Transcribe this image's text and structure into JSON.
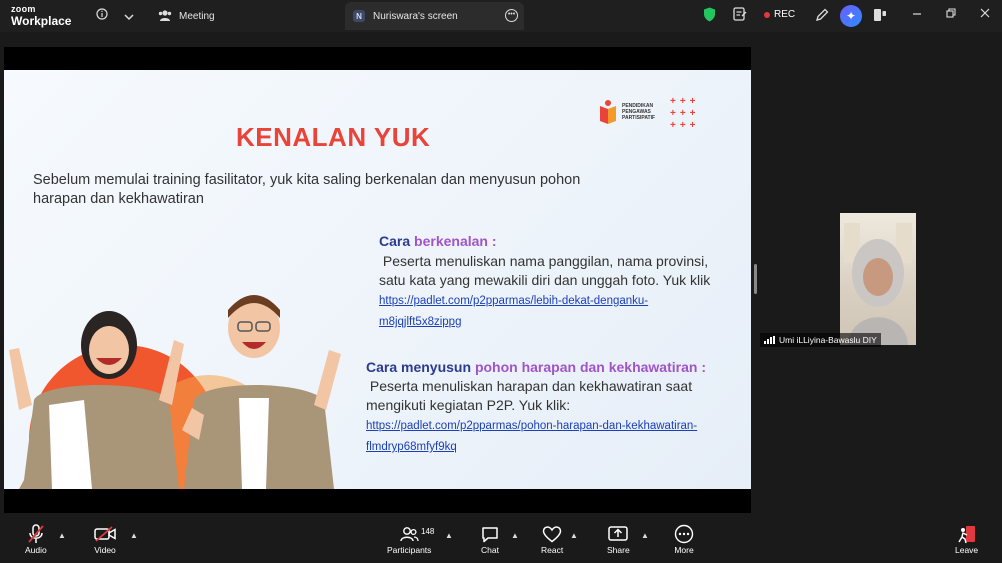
{
  "app": {
    "logo_top": "zoom",
    "logo_bottom": "Workplace"
  },
  "topbar": {
    "meeting_tab_label": "Meeting",
    "screen_tab_label": "Nuriswara's screen",
    "screen_tab_initial": "N",
    "rec_label": "REC"
  },
  "slide": {
    "title": "KENALAN YUK",
    "intro": "Sebelum memulai training fasilitator, yuk kita saling berkenalan dan menyusun pohon harapan dan kekhawatiran",
    "logo_text": [
      "PENDIDIKAN",
      "PENGAWAS",
      "PARTISIPATIF"
    ],
    "section1": {
      "heading_part1": "Cara ",
      "heading_part2": "berkenalan :",
      "body": "Peserta menuliskan nama panggilan, nama provinsi, satu kata yang  mewakili diri dan unggah foto. Yuk klik",
      "link": "https://padlet.com/p2pparmas/lebih-dekat-denganku-m8jqjlft5x8zippg"
    },
    "section2": {
      "heading_part1": "Cara menyusun ",
      "heading_part2": "pohon harapan dan kekhawatiran :",
      "body": "Peserta menuliskan harapan dan kekhawatiran saat mengikuti kegiatan P2P. Yuk klik:",
      "link": "https://padlet.com/p2pparmas/pohon-harapan-dan-kekhawatiran-flmdryp68mfyf9kq"
    }
  },
  "participant": {
    "name": "Umi iLLiyina-Bawaslu DIY"
  },
  "toolbar": {
    "audio": "Audio",
    "video": "Video",
    "participants": "Participants",
    "participants_count": "148",
    "chat": "Chat",
    "react": "React",
    "share": "Share",
    "more": "More",
    "leave": "Leave"
  },
  "colors": {
    "title_red": "#e8443a",
    "heading_blue": "#2b3b8f",
    "heading_purple": "#a054c8",
    "link_blue": "#1a3fb8",
    "shield_green": "#22c55e",
    "rec_red": "#e0393e",
    "leave_red": "#e0393e"
  }
}
